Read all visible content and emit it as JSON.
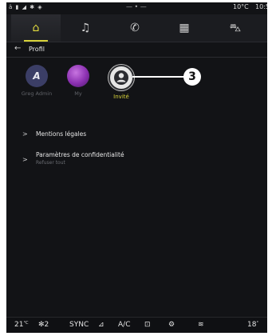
{
  "status_bar": {
    "icons": "ä ▮ ◢ ✱ ◈",
    "center": "— • —",
    "temperature": "10°C",
    "time": "10:5"
  },
  "top_nav": [
    {
      "name": "home",
      "icon": "⌂",
      "active": true
    },
    {
      "name": "music",
      "icon": "♫",
      "active": false
    },
    {
      "name": "phone",
      "icon": "✆",
      "active": false
    },
    {
      "name": "apps",
      "icon": "▦",
      "active": false
    },
    {
      "name": "car",
      "icon": "⛍",
      "active": false
    }
  ],
  "header": {
    "back_icon": "←",
    "title": "Profil"
  },
  "profiles": [
    {
      "label": "Greg Admin",
      "selected": false
    },
    {
      "label": "My",
      "selected": false
    },
    {
      "label": "Invité",
      "selected": true
    }
  ],
  "callout": {
    "number": "3"
  },
  "menu": {
    "item1": {
      "label": "Mentions légales"
    },
    "item2": {
      "label": "Paramètres de confidentialité",
      "sublabel": "Refuser tout"
    }
  },
  "bottom_bar": {
    "left_temp": "21",
    "left_temp_unit": "°C",
    "fan": "2",
    "sync": "SYNC",
    "ac": "A/C",
    "right_temp": "18",
    "right_temp_unit": "°"
  }
}
